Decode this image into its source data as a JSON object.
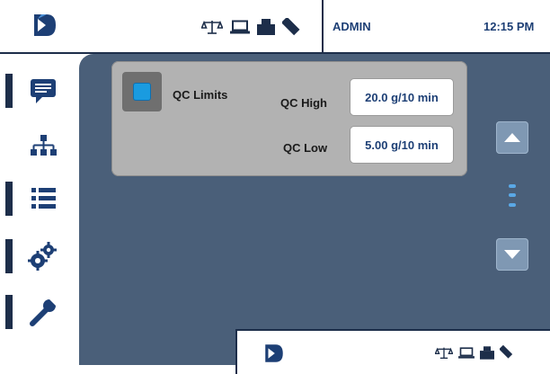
{
  "header": {
    "logo_icon": "app-logo-icon",
    "status_icons": [
      "scale-icon",
      "laptop-icon",
      "printer-icon",
      "usb-icon"
    ],
    "user": "ADMIN",
    "time": "12:15 PM"
  },
  "sidebar": {
    "items": [
      {
        "icon": "message-icon"
      },
      {
        "icon": "network-icon",
        "active": true
      },
      {
        "icon": "list-icon"
      },
      {
        "icon": "gears-icon"
      },
      {
        "icon": "wrench-icon"
      }
    ]
  },
  "qc_limits": {
    "enabled": true,
    "label": "QC Limits",
    "high_label": "QC High",
    "high_value": "20.0 g/10 min",
    "low_label": "QC Low",
    "low_value": "5.00 g/10 min"
  },
  "scroller": {
    "up_icon": "chevron-up-icon",
    "down_icon": "chevron-down-icon"
  },
  "colors": {
    "panel_bg": "#4a5f79",
    "accent": "#1a9be0",
    "navy": "#1d2e4a",
    "value_text": "#1d3f75"
  }
}
